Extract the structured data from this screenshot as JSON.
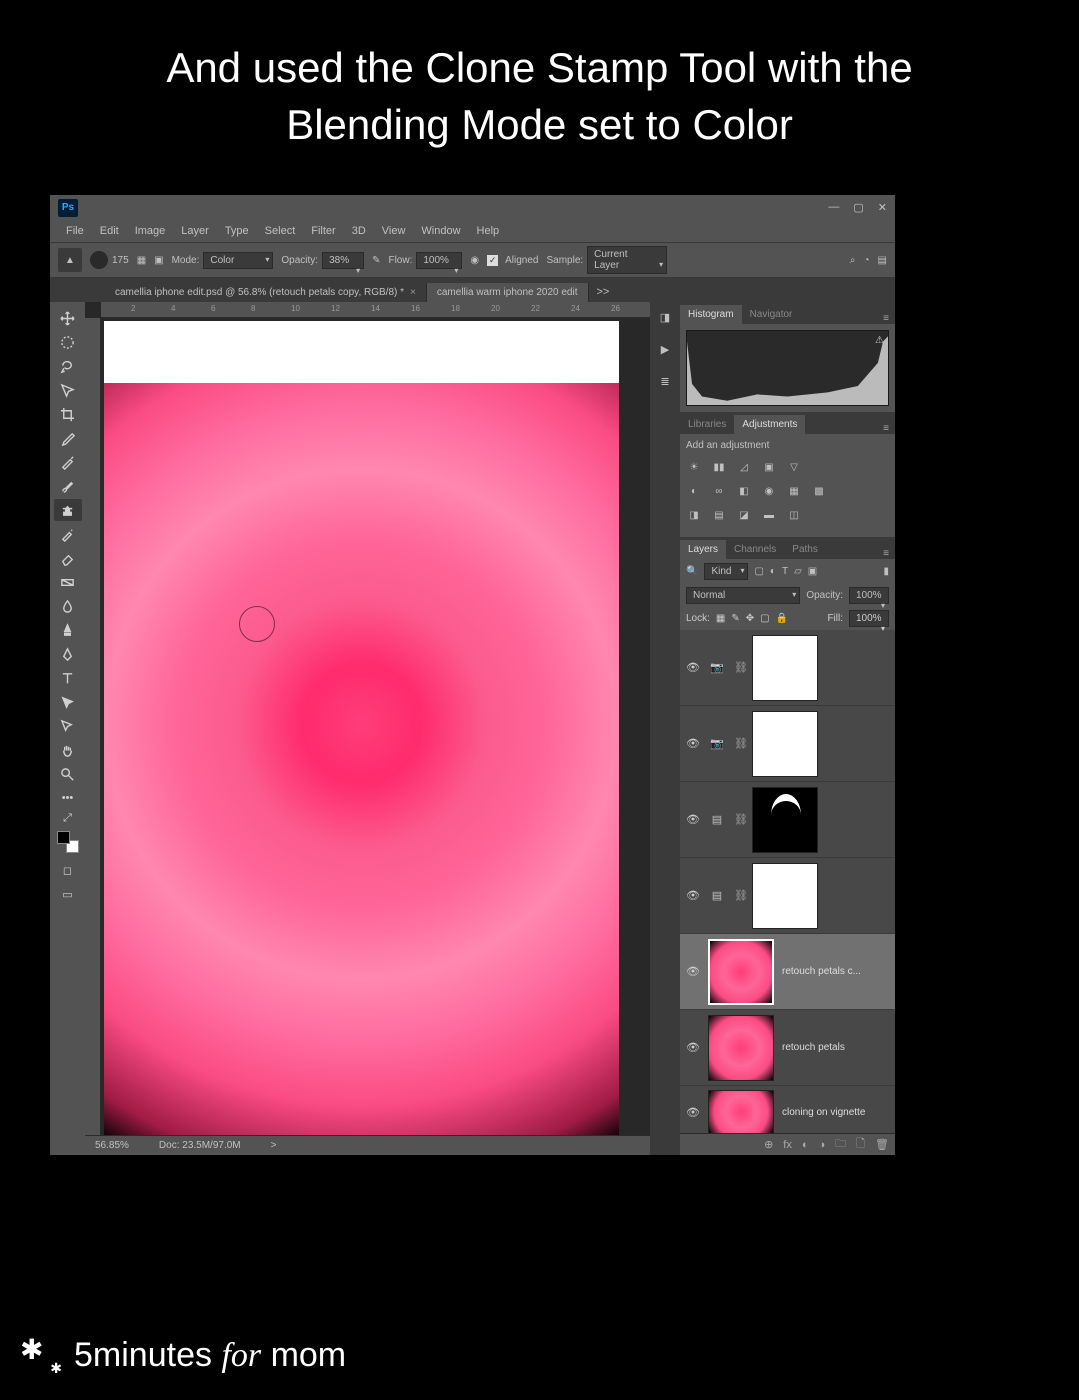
{
  "caption_line1": "And used the Clone Stamp Tool with the",
  "caption_line2": "Blending Mode set to Color",
  "ps_logo": "Ps",
  "menu": [
    "File",
    "Edit",
    "Image",
    "Layer",
    "Type",
    "Select",
    "Filter",
    "3D",
    "View",
    "Window",
    "Help"
  ],
  "options": {
    "brush_size": "175",
    "mode_label": "Mode:",
    "mode_value": "Color",
    "opacity_label": "Opacity:",
    "opacity_value": "38%",
    "flow_label": "Flow:",
    "flow_value": "100%",
    "aligned_label": "Aligned",
    "sample_label": "Sample:",
    "sample_value": "Current Layer"
  },
  "tabs": {
    "active": "camellia iphone edit.psd @ 56.8% (retouch petals copy, RGB/8) *",
    "other": "camellia warm iphone 2020 edit",
    "overflow": ">>"
  },
  "ruler_marks": [
    "2",
    "4",
    "6",
    "8",
    "10",
    "12",
    "14",
    "16",
    "18",
    "20",
    "22",
    "24",
    "26"
  ],
  "status": {
    "zoom": "56.85%",
    "doc": "Doc: 23.5M/97.0M",
    "arrow": ">"
  },
  "panels": {
    "histogram": "Histogram",
    "navigator": "Navigator",
    "libraries": "Libraries",
    "adjustments": "Adjustments",
    "add_adjustment": "Add an adjustment",
    "layers": "Layers",
    "channels": "Channels",
    "paths": "Paths"
  },
  "layer_filter": {
    "kind": "Kind"
  },
  "layer_opts": {
    "blend": "Normal",
    "opacity_label": "Opacity:",
    "opacity": "100%",
    "lock_label": "Lock:",
    "fill_label": "Fill:",
    "fill": "100%"
  },
  "layers": [
    {
      "name": "",
      "kind": "camera",
      "thumb": "white"
    },
    {
      "name": "",
      "kind": "camera",
      "thumb": "white"
    },
    {
      "name": "",
      "kind": "adj",
      "thumb": "arc"
    },
    {
      "name": "",
      "kind": "adj",
      "thumb": "white"
    },
    {
      "name": "retouch petals c...",
      "kind": "img",
      "thumb": "flower",
      "selected": true
    },
    {
      "name": "retouch petals",
      "kind": "img",
      "thumb": "flower"
    },
    {
      "name": "cloning on vignette",
      "kind": "img",
      "thumb": "flower"
    }
  ],
  "layers_footer": [
    "⊕",
    "fx",
    "◐",
    "◑",
    "🗀",
    "🗋",
    "🗑"
  ],
  "brand": {
    "five": "5",
    "minutes": "minutes",
    "for": "for",
    "mom": "mom"
  }
}
